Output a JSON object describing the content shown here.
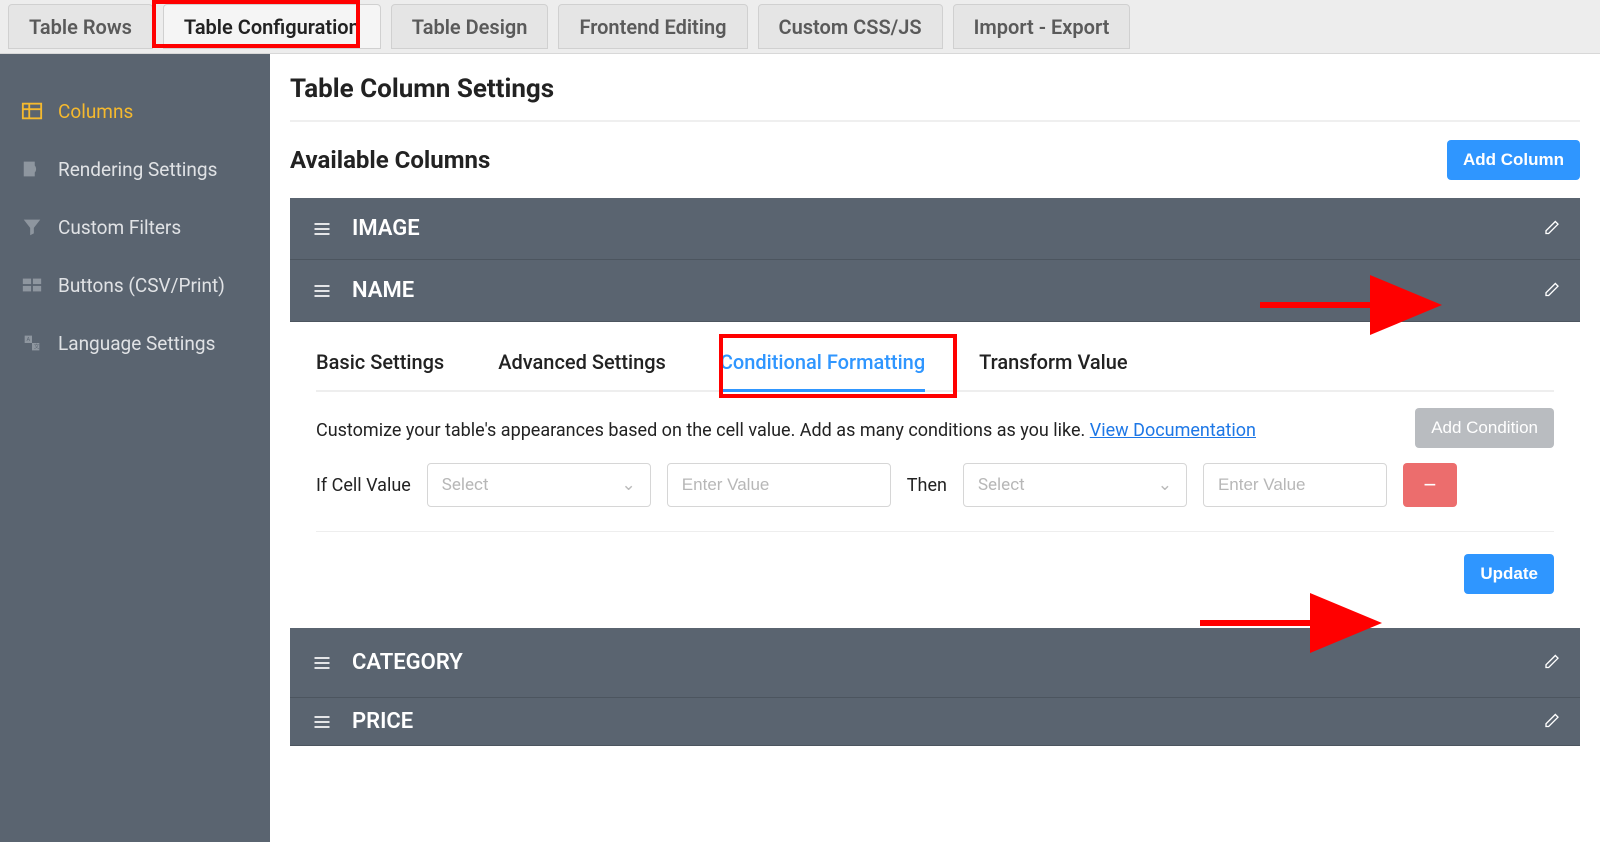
{
  "topTabs": [
    {
      "label": "Table Rows"
    },
    {
      "label": "Table Configuration"
    },
    {
      "label": "Table Design"
    },
    {
      "label": "Frontend Editing"
    },
    {
      "label": "Custom CSS/JS"
    },
    {
      "label": "Import - Export"
    }
  ],
  "sidebar": {
    "items": [
      {
        "label": "Columns",
        "icon": "columns-icon"
      },
      {
        "label": "Rendering Settings",
        "icon": "render-icon"
      },
      {
        "label": "Custom Filters",
        "icon": "funnel-icon"
      },
      {
        "label": "Buttons (CSV/Print)",
        "icon": "buttons-icon"
      },
      {
        "label": "Language Settings",
        "icon": "language-icon"
      }
    ]
  },
  "page": {
    "title": "Table Column Settings",
    "availableTitle": "Available Columns",
    "addColumnBtn": "Add Column"
  },
  "columns": [
    {
      "label": "IMAGE"
    },
    {
      "label": "NAME"
    },
    {
      "label": "CATEGORY"
    },
    {
      "label": "PRICE"
    }
  ],
  "subTabs": [
    {
      "label": "Basic Settings"
    },
    {
      "label": "Advanced Settings"
    },
    {
      "label": "Conditional Formatting"
    },
    {
      "label": "Transform Value"
    }
  ],
  "conditional": {
    "description": "Customize your table's appearances based on the cell value. Add as many conditions as you like. ",
    "docLink": "View Documentation",
    "addConditionBtn": "Add Condition",
    "ifLabel": "If Cell Value",
    "thenLabel": "Then",
    "selectPlaceholder": "Select",
    "valuePlaceholder": "Enter Value",
    "removeBtn": "−",
    "updateBtn": "Update"
  }
}
